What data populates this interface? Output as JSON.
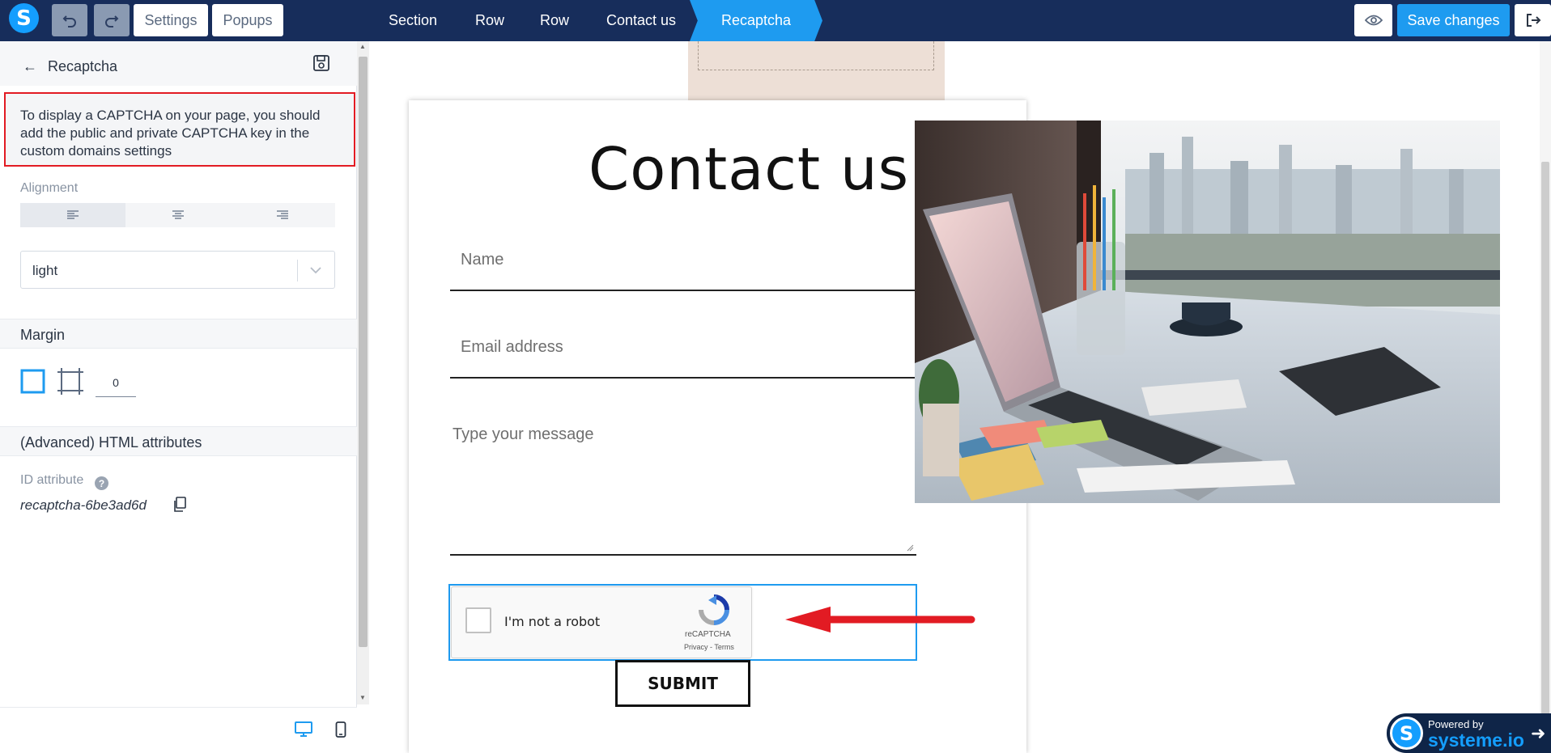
{
  "topbar": {
    "logo_letter": "S",
    "settings_label": "Settings",
    "popups_label": "Popups",
    "breadcrumbs": [
      "Section",
      "Row",
      "Row",
      "Contact us",
      "Recaptcha"
    ],
    "save_label": "Save changes"
  },
  "panel": {
    "title": "Recaptcha",
    "notice": "To display a CAPTCHA on your page, you should add the public and private CAPTCHA key in the custom domains settings",
    "alignment_label": "Alignment",
    "alignment_selected": "left",
    "theme_value": "light",
    "margin_label": "Margin",
    "margin_value": "0",
    "advanced_label": "(Advanced) HTML attributes",
    "id_label": "ID attribute",
    "help_glyph": "?",
    "id_value": "recaptcha-6be3ad6d"
  },
  "canvas": {
    "title": "Contact us",
    "name_placeholder": "Name",
    "email_placeholder": "Email address",
    "message_placeholder": "Type your message",
    "recaptcha": {
      "label": "I'm not a robot",
      "brand": "reCAPTCHA",
      "links": "Privacy - Terms"
    },
    "submit_label": "SUBMIT"
  },
  "powered": {
    "small": "Powered by",
    "big": "systeme.io"
  },
  "colors": {
    "topbar": "#172d5b",
    "accent": "#1e9bf0",
    "annotation_red": "#e21b23"
  }
}
